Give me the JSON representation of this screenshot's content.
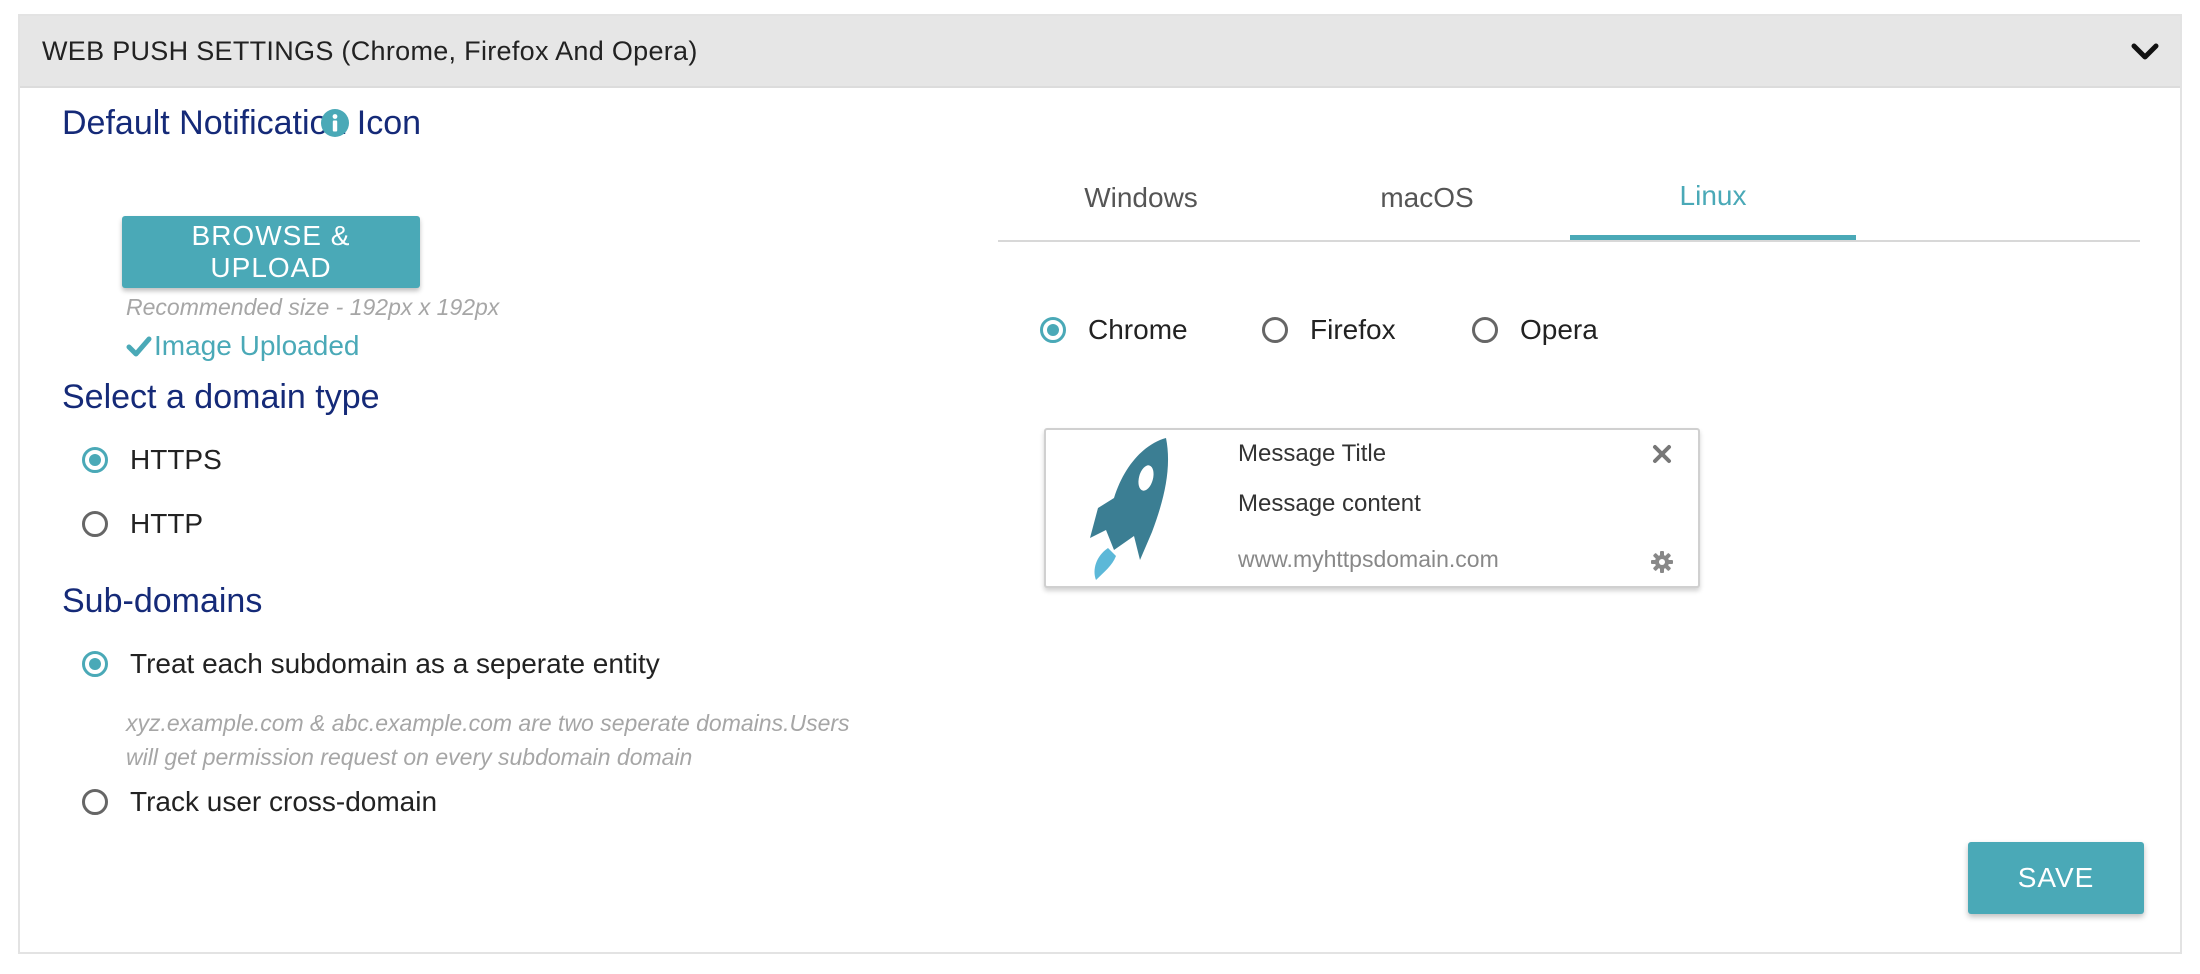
{
  "panel": {
    "title": "WEB PUSH SETTINGS (Chrome, Firefox And Opera)"
  },
  "icon_section": {
    "heading": "Default Notification Icon",
    "upload_label": "BROWSE & UPLOAD",
    "recommended": "Recommended size - 192px x 192px",
    "status": "Image Uploaded"
  },
  "domain_type": {
    "heading": "Select a domain type",
    "options": [
      {
        "label": "HTTPS",
        "selected": true
      },
      {
        "label": "HTTP",
        "selected": false
      }
    ]
  },
  "subdomains": {
    "heading": "Sub-domains",
    "options": [
      {
        "label": "Treat each subdomain as a seperate entity",
        "selected": true
      },
      {
        "label": "Track user cross-domain",
        "selected": false
      }
    ],
    "hint_line1": "xyz.example.com & abc.example.com are two seperate domains.Users",
    "hint_line2": "will get permission request on every subdomain domain"
  },
  "os_tabs": {
    "items": [
      "Windows",
      "macOS",
      "Linux"
    ],
    "active": "Linux"
  },
  "browsers": {
    "options": [
      {
        "label": "Chrome",
        "selected": true
      },
      {
        "label": "Firefox",
        "selected": false
      },
      {
        "label": "Opera",
        "selected": false
      }
    ]
  },
  "preview": {
    "title": "Message Title",
    "content": "Message content",
    "url": "www.myhttpsdomain.com"
  },
  "actions": {
    "save_label": "SAVE"
  },
  "colors": {
    "accent": "#4aa9b7",
    "heading": "#152a78",
    "header_bg": "#e6e6e6"
  }
}
